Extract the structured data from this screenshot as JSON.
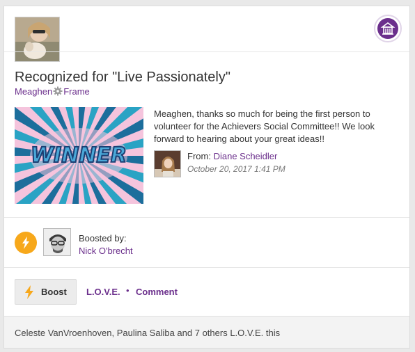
{
  "post": {
    "title": "Recognized for \"Live Passionately\"",
    "recipient_first": "Meaghen",
    "recipient_last": "Frame",
    "badge_text": "WINNER",
    "message": "Meaghen, thanks so much for being the first person to volunteer for the Achievers Social Committee!! We look forward to hearing about your great ideas!!",
    "from_label": "From:",
    "from_name": "Diane Scheidler",
    "date": "October 20, 2017 1:41 PM"
  },
  "boost": {
    "boosted_by_label": "Boosted by:",
    "booster_name": "Nick O'brecht"
  },
  "actions": {
    "boost_label": "Boost",
    "love_label": "L.O.V.E.",
    "separator": "•",
    "comment_label": "Comment"
  },
  "footer": {
    "likes_text": "Celeste VanVroenhoven, Paulina Saliba and 7 others L.O.V.E. this"
  },
  "colors": {
    "accent": "#6b2f8c",
    "boost": "#f7a81b"
  },
  "icons": {
    "brand": "building-icon",
    "gear": "gear-icon",
    "bolt": "lightning-bolt-icon"
  }
}
